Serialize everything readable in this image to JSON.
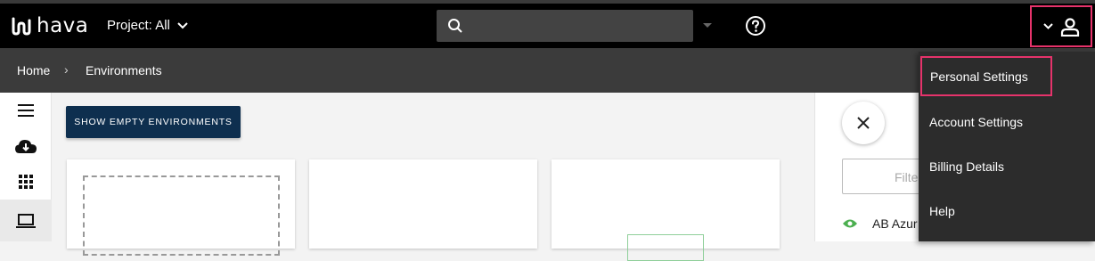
{
  "header": {
    "logo_text": "hava",
    "project_label": "Project: All",
    "search_placeholder": "",
    "help_icon": "question-circle-icon",
    "user_icon": "user-icon"
  },
  "breadcrumb": {
    "home": "Home",
    "separator": "›",
    "current": "Environments"
  },
  "sidebar": {
    "items": [
      {
        "icon": "menu-icon"
      },
      {
        "icon": "cloud-download-icon"
      },
      {
        "icon": "grid-icon"
      },
      {
        "icon": "laptop-icon",
        "active": true
      }
    ]
  },
  "main": {
    "show_empty_label": "SHOW EMPTY ENVIRONMENTS"
  },
  "right_panel": {
    "filter_placeholder": "Filte",
    "env_name": "AB Azur"
  },
  "user_menu": {
    "items": [
      {
        "label": "Personal Settings",
        "highlighted": true
      },
      {
        "label": "Account Settings"
      },
      {
        "label": "Billing Details"
      },
      {
        "label": "Help"
      }
    ]
  },
  "colors": {
    "highlight": "#e6336b",
    "primary_button": "#0e2f4f",
    "header_bg": "#000000",
    "breadcrumb_bg": "#3b3b3b",
    "menu_bg": "#2c2c2c",
    "eye_icon": "#4caf50"
  }
}
